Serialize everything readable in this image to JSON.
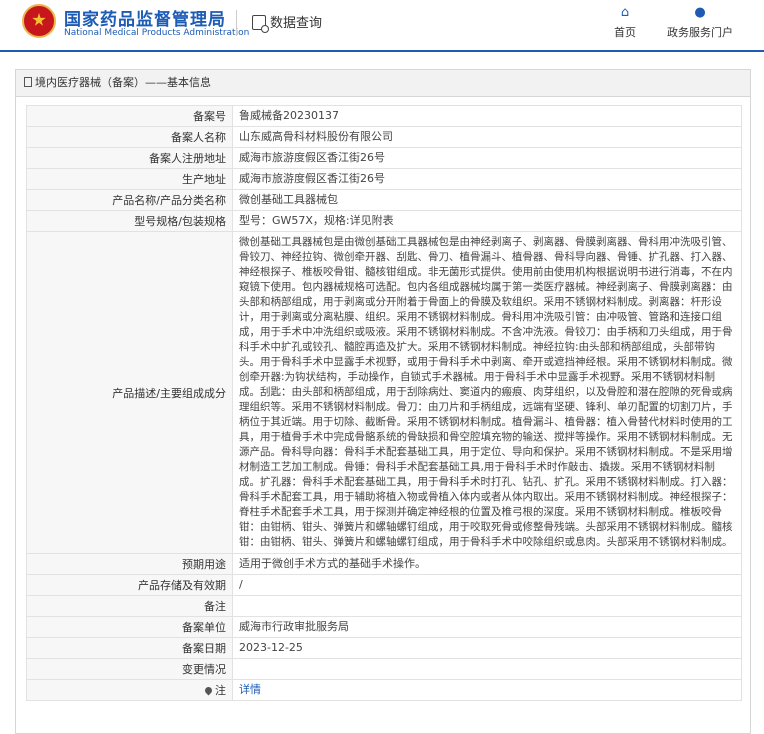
{
  "header": {
    "brand_cn": "国家药品监督管理局",
    "brand_en": "National Medical Products Administration",
    "query_label": "数据查询",
    "nav": [
      {
        "label": "首页",
        "icon": "home-icon"
      },
      {
        "label": "政务服务门户",
        "icon": "user-icon"
      }
    ],
    "brand_color": "#1d5bb5"
  },
  "breadcrumb": "境内医疗器械（备案）——基本信息",
  "rows": [
    {
      "key": "备案号",
      "value": "鲁威械备20230137"
    },
    {
      "key": "备案人名称",
      "value": "山东威高骨科材料股份有限公司"
    },
    {
      "key": "备案人注册地址",
      "value": "威海市旅游度假区香江街26号"
    },
    {
      "key": "生产地址",
      "value": "威海市旅游度假区香江街26号"
    },
    {
      "key": "产品名称/产品分类名称",
      "value": "微创基础工具器械包"
    },
    {
      "key": "型号规格/包装规格",
      "value": "型号：GW57X，规格:详见附表"
    },
    {
      "key": "产品描述/主要组成成分",
      "value": "微创基础工具器械包是由微创基础工具器械包是由神经剥离子、剥离器、骨膜剥离器、骨科用冲洗吸引管、骨铰刀、神经拉钩、微创牵开器、刮匙、骨刀、植骨漏斗、植骨器、骨科导向器、骨锤、扩孔器、打入器、神经根探子、椎板咬骨钳、髓核钳组成。非无菌形式提供。使用前由使用机构根据说明书进行消毒，不在内窥镜下使用。包内器械规格可选配。包内各组成器械均属于第一类医疗器械。神经剥离子、骨膜剥离器：由头部和柄部组成，用于剥离或分开附着于骨面上的骨膜及软组织。采用不锈钢材料制成。剥离器：杆形设计，用于剥离或分离粘膜、组织。采用不锈钢材料制成。骨科用冲洗吸引管：由冲吸管、管路和连接口组成，用于手术中冲洗组织或吸液。采用不锈钢材料制成。不含冲洗液。骨铰刀：由手柄和刀头组成，用于骨科手术中扩孔或铰孔、髓腔再造及扩大。采用不锈钢材料制成。神经拉钩:由头部和柄部组成，头部带钩头。用于骨科手术中显露手术视野，或用于骨科手术中剥离、牵开或遮挡神经根。采用不锈钢材料制成。微创牵开器:为钩状结构，手动操作，自锁式手术器械。用于骨科手术中显露手术视野。采用不锈钢材料制成。刮匙：由头部和柄部组成，用于刮除病灶、窦道内的瘢痕、肉芽组织，以及骨腔和潜在腔隙的死骨或病理组织等。采用不锈钢材料制成。骨刀：由刀片和手柄组成，远端有坚硬、锋利、单刃配置的切割刀片，手柄位于其近端。用于切除、截断骨。采用不锈钢材料制成。植骨漏斗、植骨器：植入骨替代材料时使用的工具，用于植骨手术中完成骨骼系统的骨缺损和骨空腔填充物的输送、搅拌等操作。采用不锈钢材料制成。无源产品。骨科导向器：骨科手术配套基础工具，用于定位、导向和保护。采用不锈钢材料制成。不是采用增材制造工艺加工制成。骨锤：骨科手术配套基础工具,用于骨科手术时作敲击、撬拨。采用不锈钢材料制成。扩孔器：骨科手术配套基础工具，用于骨科手术时打孔、钻孔、扩孔。采用不锈钢材料制成。打入器：骨科手术配套工具，用于辅助将植入物或骨植入体内或者从体内取出。采用不锈钢材料制成。神经根探子：脊柱手术配套手术工具，用于探测并确定神经根的位置及椎弓根的深度。采用不锈钢材料制成。椎板咬骨钳：由钳柄、钳头、弹簧片和螺轴螺钉组成，用于咬取死骨或修整骨残端。头部采用不锈钢材料制成。髓核钳：由钳柄、钳头、弹簧片和螺轴螺钉组成，用于骨科手术中咬除组织或息肉。头部采用不锈钢材料制成。"
    },
    {
      "key": "预期用途",
      "value": "适用于微创手术方式的基础手术操作。"
    },
    {
      "key": "产品存储及有效期",
      "value": "/"
    },
    {
      "key": "备注",
      "value": ""
    },
    {
      "key": "备案单位",
      "value": "威海市行政审批服务局"
    },
    {
      "key": "备案日期",
      "value": "2023-12-25"
    },
    {
      "key": "变更情况",
      "value": ""
    }
  ],
  "note_row": {
    "key": "注",
    "link": "详情"
  }
}
